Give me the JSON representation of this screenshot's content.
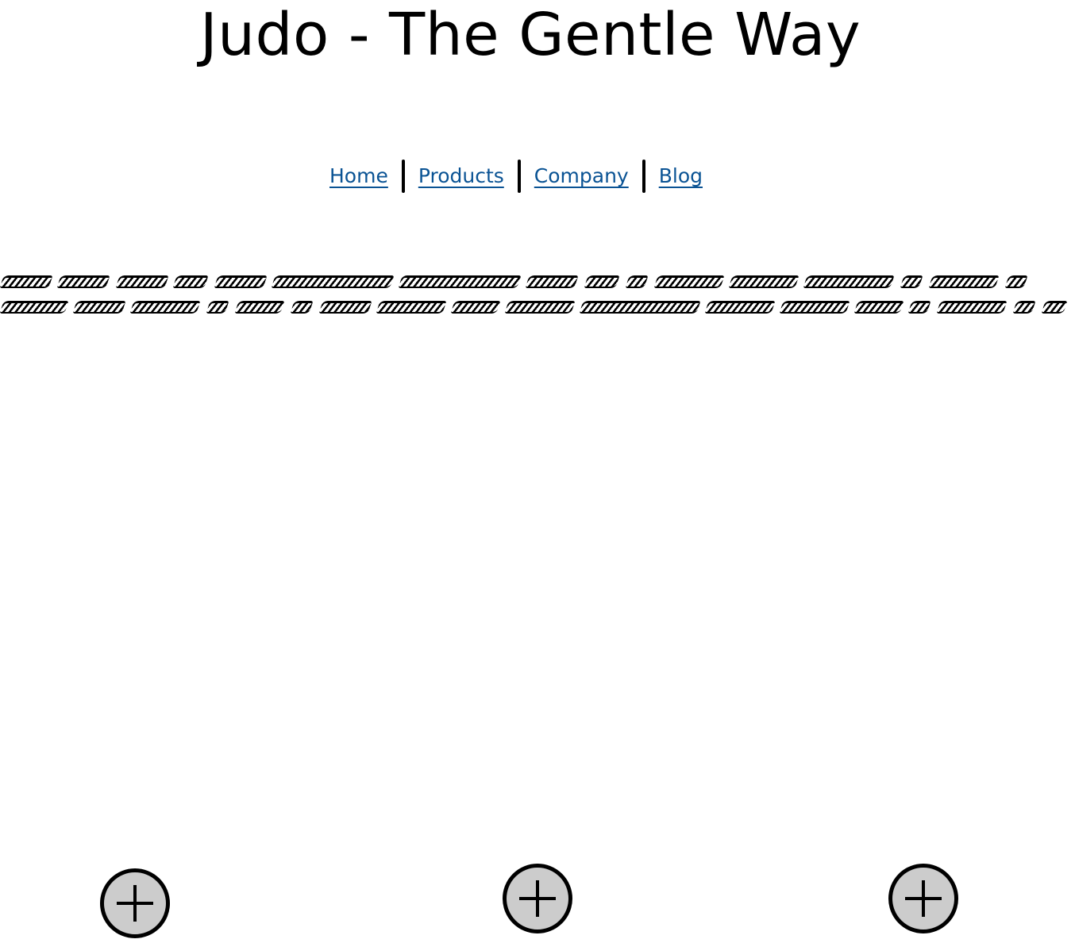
{
  "header": {
    "title": "Judo - The Gentle Way"
  },
  "nav": {
    "items": [
      {
        "label": "Home"
      },
      {
        "label": "Products"
      },
      {
        "label": "Company"
      },
      {
        "label": "Blog"
      }
    ],
    "link_color": "#0a5394"
  },
  "content": {
    "placeholder_text_lines": 2
  },
  "buttons": {
    "add_icon": "plus-icon",
    "fill_color": "#cccccc",
    "count": 3
  }
}
